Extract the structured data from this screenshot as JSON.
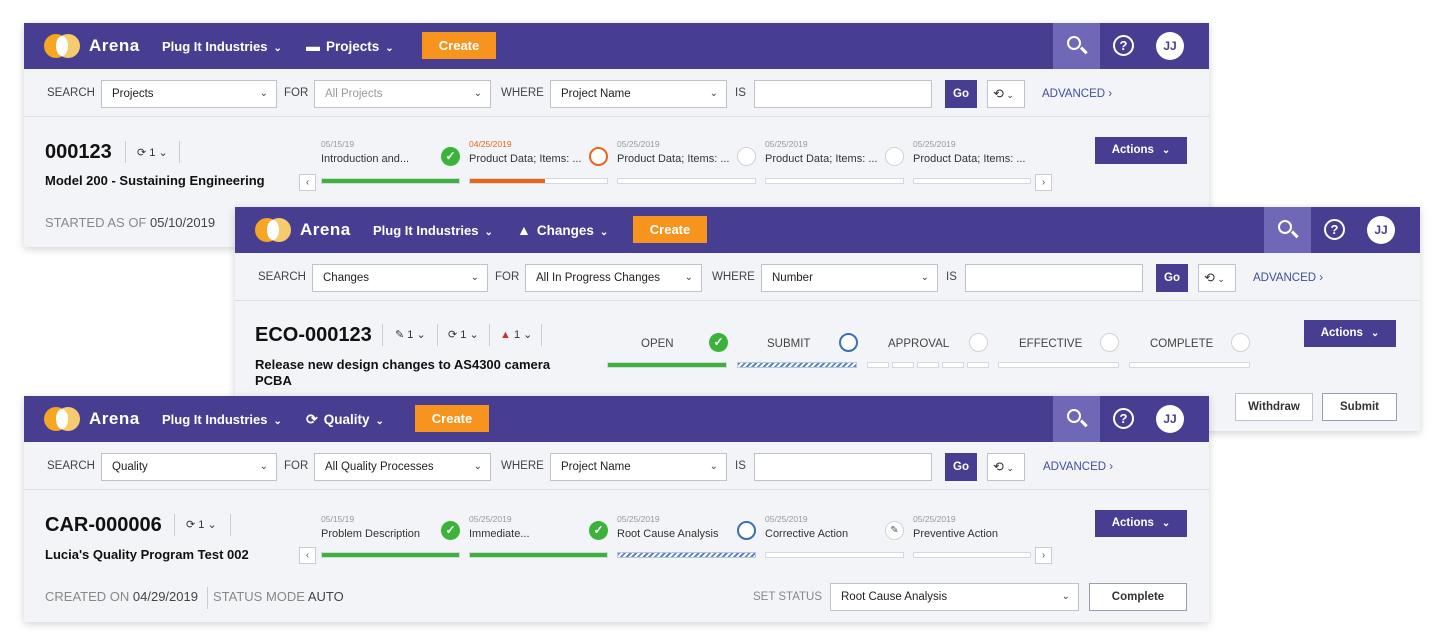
{
  "common": {
    "brand": "Arena",
    "org": "Plug It Industries",
    "create": "Create",
    "user_initials": "JJ",
    "help": "?",
    "search_label": "SEARCH",
    "for_label": "FOR",
    "where_label": "WHERE",
    "is_label": "IS",
    "go": "Go",
    "advanced": "ADVANCED",
    "actions": "Actions",
    "history_icon": "⟲"
  },
  "projects": {
    "module": "Projects",
    "search_type": "Projects",
    "for_value": "All Projects",
    "where_value": "Project Name",
    "record_id": "000123",
    "revision": "1",
    "title": "Model 200 - Sustaining Engineering",
    "started_label": "STARTED AS OF",
    "started_value": "05/10/2019",
    "steps": [
      {
        "date": "05/15/19",
        "name": "Introduction and...",
        "status": "done"
      },
      {
        "date": "04/25/2019",
        "name": "Product Data; Items: ...",
        "status": "current"
      },
      {
        "date": "05/25/2019",
        "name": "Product Data; Items: ...",
        "status": "todo"
      },
      {
        "date": "05/25/2019",
        "name": "Product Data; Items: ...",
        "status": "todo"
      },
      {
        "date": "05/25/2019",
        "name": "Product Data; Items: ...",
        "status": "todo"
      }
    ],
    "progress": [
      1.0,
      0.55,
      0,
      0,
      0
    ]
  },
  "changes": {
    "module": "Changes",
    "search_type": "Changes",
    "for_value": "All In Progress Changes",
    "where_value": "Number",
    "record_id": "ECO-000123",
    "counts": {
      "items": "1",
      "revisions": "1",
      "alerts": "1"
    },
    "title": "Release new design changes to AS4300 camera PCBA",
    "phases": [
      "OPEN",
      "SUBMIT",
      "APPROVAL",
      "EFFECTIVE",
      "COMPLETE"
    ],
    "withdraw": "Withdraw",
    "submit": "Submit"
  },
  "quality": {
    "module": "Quality",
    "search_type": "Quality",
    "for_value": "All Quality Processes",
    "where_value": "Project Name",
    "record_id": "CAR-000006",
    "revision": "1",
    "title": "Lucia's Quality Program Test 002",
    "created_label": "CREATED ON",
    "created_value": "04/29/2019",
    "status_mode_label": "STATUS MODE",
    "status_mode_value": "AUTO",
    "set_status_label": "SET STATUS",
    "set_status_value": "Root Cause Analysis",
    "complete": "Complete",
    "steps": [
      {
        "date": "05/15/19",
        "name": "Problem Description",
        "status": "done"
      },
      {
        "date": "05/25/2019",
        "name": "Immediate...",
        "status": "done"
      },
      {
        "date": "05/25/2019",
        "name": "Root Cause Analysis",
        "status": "done"
      },
      {
        "date": "05/25/2019",
        "name": "Corrective Action",
        "status": "current"
      },
      {
        "date": "05/25/2019",
        "name": "Preventive Action",
        "status": "todo"
      }
    ]
  },
  "colors": {
    "nav": "#473e92",
    "create": "#f7941d",
    "done": "#3bb33b",
    "current_orange": "#e8661a",
    "current_blue": "#3a6fb5"
  }
}
